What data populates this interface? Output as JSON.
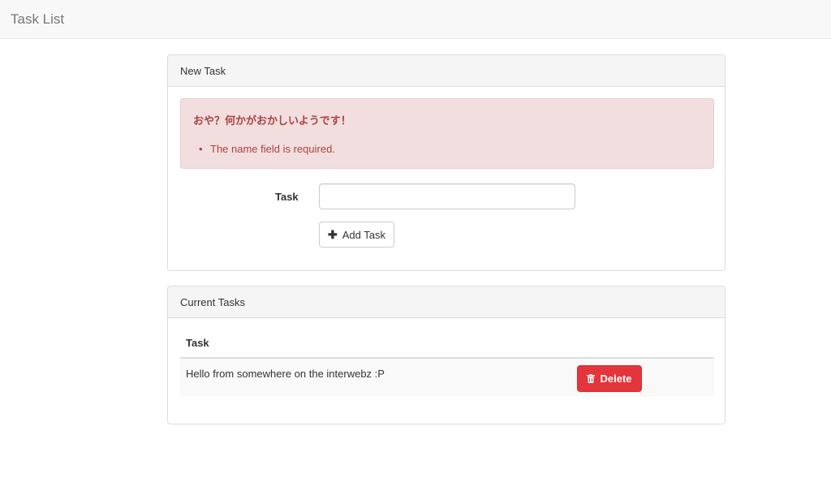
{
  "navbar": {
    "brand": "Task List"
  },
  "new_task_panel": {
    "heading": "New Task",
    "alert": {
      "title": "おや？何かがおかしいようです！",
      "errors": [
        "The name field is required."
      ]
    },
    "form": {
      "task_label": "Task",
      "task_value": "",
      "add_button_label": "Add Task",
      "add_icon": "plus-icon"
    }
  },
  "current_tasks_panel": {
    "heading": "Current Tasks",
    "table": {
      "columns": [
        "Task"
      ],
      "rows": [
        {
          "task": "Hello from somewhere on the interwebz :P",
          "delete_label": "Delete",
          "delete_icon": "trash-icon"
        }
      ]
    }
  },
  "colors": {
    "alert_bg": "#f2dede",
    "alert_text": "#a94442",
    "delete_button": "#e3353b"
  }
}
